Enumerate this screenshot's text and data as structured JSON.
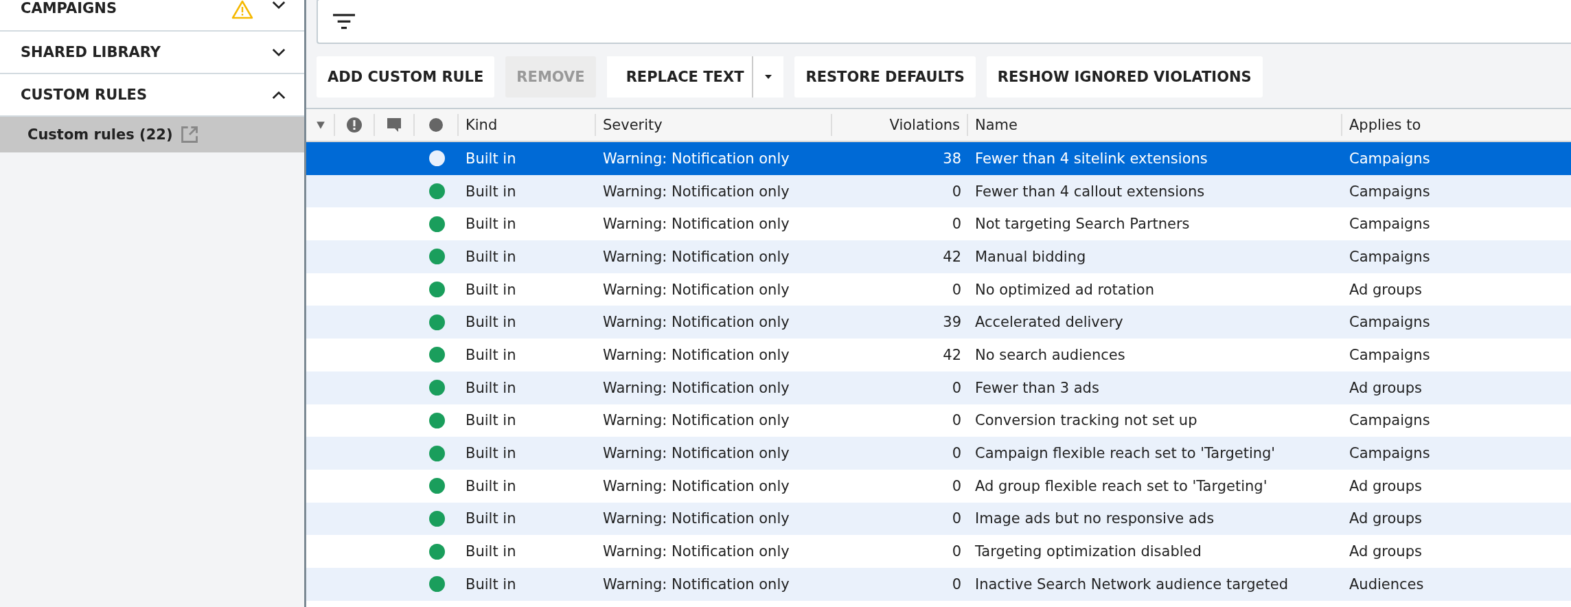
{
  "sidebar": {
    "sections": [
      {
        "label": "CAMPAIGNS",
        "warning": true,
        "expanded": false
      },
      {
        "label": "SHARED LIBRARY",
        "warning": false,
        "expanded": false
      },
      {
        "label": "CUSTOM RULES",
        "warning": false,
        "expanded": true,
        "items": [
          {
            "label": "Custom rules (22)",
            "selected": true
          }
        ]
      }
    ]
  },
  "toolbar": {
    "buttons": [
      {
        "label": "ADD CUSTOM RULE",
        "kind": "plain",
        "disabled": false
      },
      {
        "label": "REMOVE",
        "kind": "plain",
        "disabled": true
      },
      {
        "label": "REPLACE TEXT",
        "kind": "split",
        "disabled": false
      },
      {
        "label": "RESTORE DEFAULTS",
        "kind": "plain",
        "disabled": false
      },
      {
        "label": "RESHOW IGNORED VIOLATIONS",
        "kind": "plain",
        "disabled": false
      }
    ]
  },
  "table": {
    "columns": [
      "Kind",
      "Severity",
      "Violations",
      "Name",
      "Applies to"
    ],
    "rows": [
      {
        "selected": true,
        "color": "#e8f0fc",
        "kind": "Built in",
        "severity": "Warning: Notification only",
        "violations": "38",
        "name": "Fewer than 4 sitelink extensions",
        "applies_to": "Campaigns"
      },
      {
        "selected": false,
        "color": "#1a9e5c",
        "kind": "Built in",
        "severity": "Warning: Notification only",
        "violations": "0",
        "name": "Fewer than 4 callout extensions",
        "applies_to": "Campaigns"
      },
      {
        "selected": false,
        "color": "#1a9e5c",
        "kind": "Built in",
        "severity": "Warning: Notification only",
        "violations": "0",
        "name": "Not targeting Search Partners",
        "applies_to": "Campaigns"
      },
      {
        "selected": false,
        "color": "#1a9e5c",
        "kind": "Built in",
        "severity": "Warning: Notification only",
        "violations": "42",
        "name": "Manual bidding",
        "applies_to": "Campaigns"
      },
      {
        "selected": false,
        "color": "#1a9e5c",
        "kind": "Built in",
        "severity": "Warning: Notification only",
        "violations": "0",
        "name": "No optimized ad rotation",
        "applies_to": "Ad groups"
      },
      {
        "selected": false,
        "color": "#1a9e5c",
        "kind": "Built in",
        "severity": "Warning: Notification only",
        "violations": "39",
        "name": "Accelerated delivery",
        "applies_to": "Campaigns"
      },
      {
        "selected": false,
        "color": "#1a9e5c",
        "kind": "Built in",
        "severity": "Warning: Notification only",
        "violations": "42",
        "name": "No search audiences",
        "applies_to": "Campaigns"
      },
      {
        "selected": false,
        "color": "#1a9e5c",
        "kind": "Built in",
        "severity": "Warning: Notification only",
        "violations": "0",
        "name": "Fewer than 3 ads",
        "applies_to": "Ad groups"
      },
      {
        "selected": false,
        "color": "#1a9e5c",
        "kind": "Built in",
        "severity": "Warning: Notification only",
        "violations": "0",
        "name": "Conversion tracking not set up",
        "applies_to": "Campaigns"
      },
      {
        "selected": false,
        "color": "#1a9e5c",
        "kind": "Built in",
        "severity": "Warning: Notification only",
        "violations": "0",
        "name": "Campaign flexible reach set to 'Targeting'",
        "applies_to": "Campaigns"
      },
      {
        "selected": false,
        "color": "#1a9e5c",
        "kind": "Built in",
        "severity": "Warning: Notification only",
        "violations": "0",
        "name": "Ad group flexible reach set to 'Targeting'",
        "applies_to": "Ad groups"
      },
      {
        "selected": false,
        "color": "#1a9e5c",
        "kind": "Built in",
        "severity": "Warning: Notification only",
        "violations": "0",
        "name": "Image ads but no responsive ads",
        "applies_to": "Ad groups"
      },
      {
        "selected": false,
        "color": "#1a9e5c",
        "kind": "Built in",
        "severity": "Warning: Notification only",
        "violations": "0",
        "name": "Targeting optimization disabled",
        "applies_to": "Ad groups"
      },
      {
        "selected": false,
        "color": "#1a9e5c",
        "kind": "Built in",
        "severity": "Warning: Notification only",
        "violations": "0",
        "name": "Inactive Search Network audience targeted",
        "applies_to": "Audiences"
      }
    ]
  }
}
